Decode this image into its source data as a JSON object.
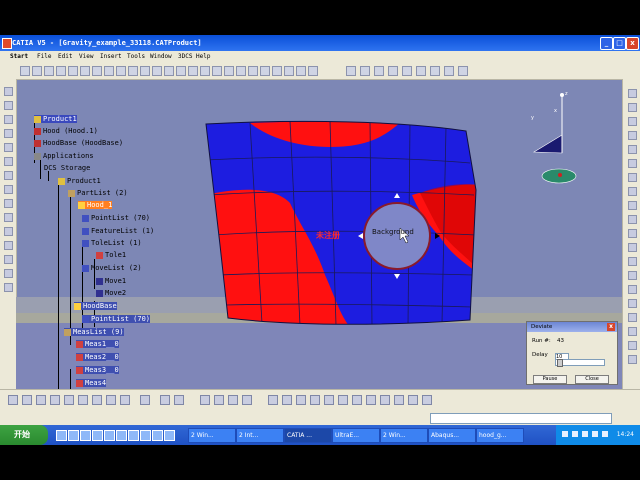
{
  "window": {
    "title": "CATIA V5 - [Gravity_example_33118.CATProduct]"
  },
  "menu": {
    "items": [
      "Start",
      "File",
      "Edit",
      "View",
      "Insert",
      "Tools",
      "Window",
      "3DCS",
      "Help"
    ]
  },
  "tree": {
    "nodes": [
      {
        "label": "Product1",
        "style": "root"
      },
      {
        "label": "Hood (Hood.1)",
        "style": ""
      },
      {
        "label": "HoodBase (HoodBase)",
        "style": ""
      },
      {
        "label": "Applications",
        "style": ""
      },
      {
        "label": "DCS Storage",
        "style": ""
      },
      {
        "label": "Product1",
        "style": ""
      },
      {
        "label": "PartList (2)",
        "style": ""
      },
      {
        "label": "Hood_1",
        "style": "hi"
      },
      {
        "label": "PointList (70)",
        "style": ""
      },
      {
        "label": "FeatureList (1)",
        "style": ""
      },
      {
        "label": "ToleList (1)",
        "style": ""
      },
      {
        "label": "Tole1",
        "style": ""
      },
      {
        "label": "MoveList (2)",
        "style": ""
      },
      {
        "label": "Move1",
        "style": ""
      },
      {
        "label": "Move2",
        "style": ""
      },
      {
        "label": "HoodBase",
        "style": "sel"
      },
      {
        "label": "PointList (70)",
        "style": "sel"
      },
      {
        "label": "MeasList (9)",
        "style": "sel"
      },
      {
        "label": "Meas1__0",
        "style": "sel"
      },
      {
        "label": "Meas2__0",
        "style": "sel"
      },
      {
        "label": "Meas3__0",
        "style": "sel"
      },
      {
        "label": "Meas4",
        "style": "sel"
      }
    ]
  },
  "viewport": {
    "watermark": "未注册",
    "background_label": "Background"
  },
  "compass": {
    "x_label": "x",
    "y_label": "y",
    "z_label": "z"
  },
  "deviate_dialog": {
    "title": "Deviate",
    "run_label": "Run #:",
    "run_value": "43",
    "delay_label": "Delay",
    "delay_value": "10",
    "pause_button": "Pause",
    "close_button": "Close"
  },
  "taskbar": {
    "start_label": "开始",
    "tasks": [
      "2 Win...",
      "2 Int...",
      "CATIA ...",
      "UltraE...",
      "2 Win...",
      "Abaqus...",
      "hood_g..."
    ],
    "clock": "14:24"
  },
  "colors": {
    "surface_blue": "#1d1de0",
    "surface_red": "#ff1010",
    "titlebar": "#0a4fd8",
    "viewport_bg": "#7d87b5"
  }
}
